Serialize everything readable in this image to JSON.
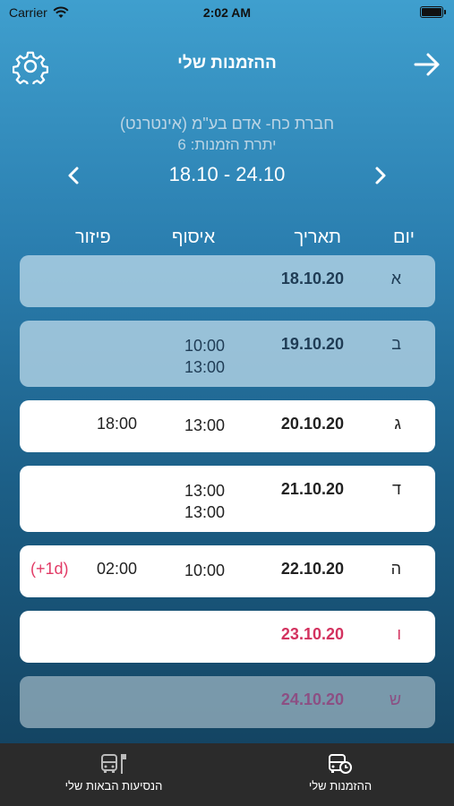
{
  "status_bar": {
    "carrier": "Carrier",
    "time": "2:02 AM"
  },
  "nav": {
    "title": "ההזמנות שלי"
  },
  "header": {
    "company": "חברת כח- אדם בע\"מ (אינטרנט)",
    "remaining": "יתרת הזמנות: 6",
    "week_range": "18.10 - 24.10"
  },
  "columns": {
    "day": "יום",
    "date": "תאריך",
    "pickup": "איסוף",
    "dropoff": "פיזור"
  },
  "rows": [
    {
      "day": "א",
      "date": "18.10.20",
      "pickup": "",
      "pickup2": "",
      "dropoff": "",
      "extra": ""
    },
    {
      "day": "ב",
      "date": "19.10.20",
      "pickup": "10:00",
      "pickup2": "13:00",
      "dropoff": "",
      "extra": ""
    },
    {
      "day": "ג",
      "date": "20.10.20",
      "pickup": "13:00",
      "pickup2": "",
      "dropoff": "18:00",
      "extra": ""
    },
    {
      "day": "ד",
      "date": "21.10.20",
      "pickup": "13:00",
      "pickup2": "13:00",
      "dropoff": "",
      "extra": ""
    },
    {
      "day": "ה",
      "date": "22.10.20",
      "pickup": "10:00",
      "pickup2": "",
      "dropoff": "02:00",
      "extra": "(+1d)"
    },
    {
      "day": "ו",
      "date": "23.10.20",
      "pickup": "",
      "pickup2": "",
      "dropoff": "",
      "extra": ""
    },
    {
      "day": "ש",
      "date": "24.10.20",
      "pickup": "",
      "pickup2": "",
      "dropoff": "",
      "extra": ""
    }
  ],
  "tabs": {
    "next_rides": "הנסיעות הבאות שלי",
    "my_orders": "ההזמנות שלי"
  },
  "icons": {
    "settings": "gear-icon",
    "back": "arrow-right-icon",
    "prev": "chevron-left-icon",
    "next": "chevron-right-icon",
    "next_rides": "bus-stop-icon",
    "my_orders": "bus-clock-icon"
  },
  "colors": {
    "accent_pink": "#d3325f",
    "weekend_text": "#8c4f83",
    "tabbar": "#2b2b2b"
  }
}
